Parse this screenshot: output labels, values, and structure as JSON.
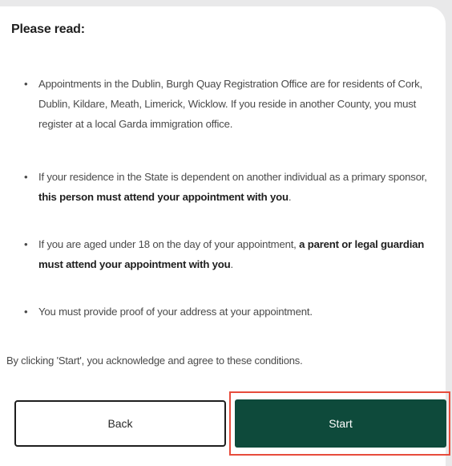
{
  "notice": {
    "title": "Please read:",
    "items": [
      {
        "text": "Appointments in the Dublin, Burgh Quay Registration Office are for residents of Cork, Dublin, Kildare, Meath, Limerick, Wicklow. If you reside in another County, you must register at a local Garda immigration office."
      },
      {
        "text": "If your residence in the State is dependent on another individual as a primary sponsor, ",
        "bold": "this person must attend your appointment with you",
        "after": "."
      },
      {
        "text": "If you are aged under 18 on the day of your appointment, ",
        "bold": "a parent or legal guardian must attend your appointment with you",
        "after": "."
      },
      {
        "text": "You must provide proof of your address at your appointment."
      }
    ],
    "acknowledgement": "By clicking 'Start', you acknowledge and agree to these conditions."
  },
  "actions": {
    "back_label": "Back",
    "start_label": "Start"
  },
  "colors": {
    "start_background": "#0e4a3b",
    "highlight_outline": "#e74c3c"
  }
}
